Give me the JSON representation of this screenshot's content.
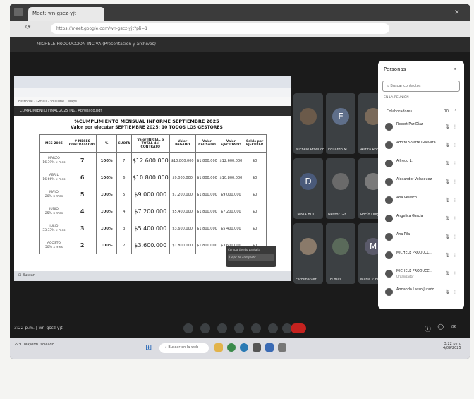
{
  "browser": {
    "tab_title": "Meet: wn-gsez-yjt",
    "url": "https://meet.google.com/wn-gscz-yjt?pli=1"
  },
  "meet": {
    "presentation_title": "MICHELE PRODUCCION INCIVA (Presentación y archivos)",
    "time_code": "3:22 p.m. | wn-gscz-yjt",
    "controls": [
      "mic-icon",
      "camera-icon",
      "captions-icon",
      "emoji-icon",
      "present-icon",
      "raise-hand-icon",
      "more-icon",
      "end-call-icon"
    ]
  },
  "shared": {
    "title_bar": "CUMPLIMIENTO FINAL 2025 ING. Aprobado.pdf",
    "bookmarks": "Historial  ·  Gmail  ·  YouTube  ·  Maps",
    "heading": "%CUMPLIMIENTO MENSUAL INFORME SEPTIEMBRE 2025",
    "subheading": "Valor por ejecutar SEPTIEMBRE 2025: 10 TODOS LOS GESTORES",
    "headers": [
      "MES 2025",
      "# MESES CONTRATADOS",
      "%",
      "CUOTA",
      "Valor INICIAL o TOTAL del CONTRATO",
      "Valor PAGADO",
      "Valor CAUSADO",
      "Valor EJECUTADO",
      "Saldo por EJECUTAR"
    ],
    "rows": [
      {
        "mes": "MARZO",
        "mes_sub": "16,39% x mes",
        "meses": "7",
        "pct": "100%",
        "cuota": "7",
        "total": "$12.600.000",
        "pagado": "$10.800.000",
        "causado": "$1.800.000",
        "ejecutado": "$12.600.000",
        "saldo": "$0"
      },
      {
        "mes": "ABRIL",
        "mes_sub": "16,66% x mes",
        "meses": "6",
        "pct": "100%",
        "cuota": "6",
        "total": "$10.800.000",
        "pagado": "$9.000.000",
        "causado": "$1.800.000",
        "ejecutado": "$10.800.000",
        "saldo": "$0"
      },
      {
        "mes": "MAYO",
        "mes_sub": "20% x mes",
        "meses": "5",
        "pct": "100%",
        "cuota": "5",
        "total": "$9.000.000",
        "pagado": "$7.200.000",
        "causado": "$1.800.000",
        "ejecutado": "$9.000.000",
        "saldo": "$0"
      },
      {
        "mes": "JUNIO",
        "mes_sub": "25% x mes",
        "meses": "4",
        "pct": "100%",
        "cuota": "4",
        "total": "$7.200.000",
        "pagado": "$5.400.000",
        "causado": "$1.800.000",
        "ejecutado": "$7.200.000",
        "saldo": "$0"
      },
      {
        "mes": "JULIO",
        "mes_sub": "33,33% x mes",
        "meses": "3",
        "pct": "100%",
        "cuota": "3",
        "total": "$5.400.000",
        "pagado": "$3.600.000",
        "causado": "$1.800.000",
        "ejecutado": "$5.400.000",
        "saldo": "$0"
      },
      {
        "mes": "AGOSTO",
        "mes_sub": "50% x mes",
        "meses": "2",
        "pct": "100%",
        "cuota": "2",
        "total": "$3.600.000",
        "pagado": "$1.800.000",
        "causado": "$1.800.000",
        "ejecutado": "$3.600.000",
        "saldo": "$0"
      }
    ],
    "popup": "Compartiendo pantalla",
    "popup_btn": "Dejar de compartir",
    "inner_taskbar": "Buscar"
  },
  "participants": [
    {
      "name": "Michele Producc...",
      "letter": "",
      "color": "#6b5a4a"
    },
    {
      "name": "Eduardo M...",
      "letter": "E",
      "color": "#5f6f8a"
    },
    {
      "name": "Aurita Rodr...",
      "letter": "",
      "color": "#7a6a5a"
    },
    {
      "name": "DANIA BUI...",
      "letter": "D",
      "color": "#4a5a7a"
    },
    {
      "name": "Nestor Gir...",
      "letter": "",
      "color": "#6a6a6a"
    },
    {
      "name": "Rocío Diego...",
      "letter": "",
      "color": "#7a7a7a"
    },
    {
      "name": "carolina ver...",
      "letter": "",
      "color": "#8a7a6a"
    },
    {
      "name": "TH más",
      "letter": "",
      "color": "#5a6a5a"
    },
    {
      "name": "Maria P. Flor",
      "letter": "M",
      "color": "#5a5a6a"
    }
  ],
  "people_panel": {
    "title": "Personas",
    "search": "Buscar contactos",
    "in_meeting": "EN LA REUNIÓN",
    "collaborators": "Colaboradores",
    "count": "10",
    "people": [
      {
        "name": "Robert Paz Díaz",
        "sub": ""
      },
      {
        "name": "Adolfo Solarte Guevara",
        "sub": ""
      },
      {
        "name": "Alfredo L.",
        "sub": ""
      },
      {
        "name": "Alexander Velasquez",
        "sub": ""
      },
      {
        "name": "Ana Velasco",
        "sub": ""
      },
      {
        "name": "Angelica Garcia",
        "sub": ""
      },
      {
        "name": "Ana Pila",
        "sub": ""
      },
      {
        "name": "MICHELE PRODUCC...",
        "sub": ""
      },
      {
        "name": "MICHELE PRODUCC...",
        "sub": "Organizador"
      },
      {
        "name": "Armando Lasso Jurado",
        "sub": ""
      }
    ]
  },
  "taskbar": {
    "weather": "29°C Mayorm. soleado",
    "search": "Buscar en la web",
    "time": "3:22 p.m.",
    "date": "4/09/2025"
  }
}
